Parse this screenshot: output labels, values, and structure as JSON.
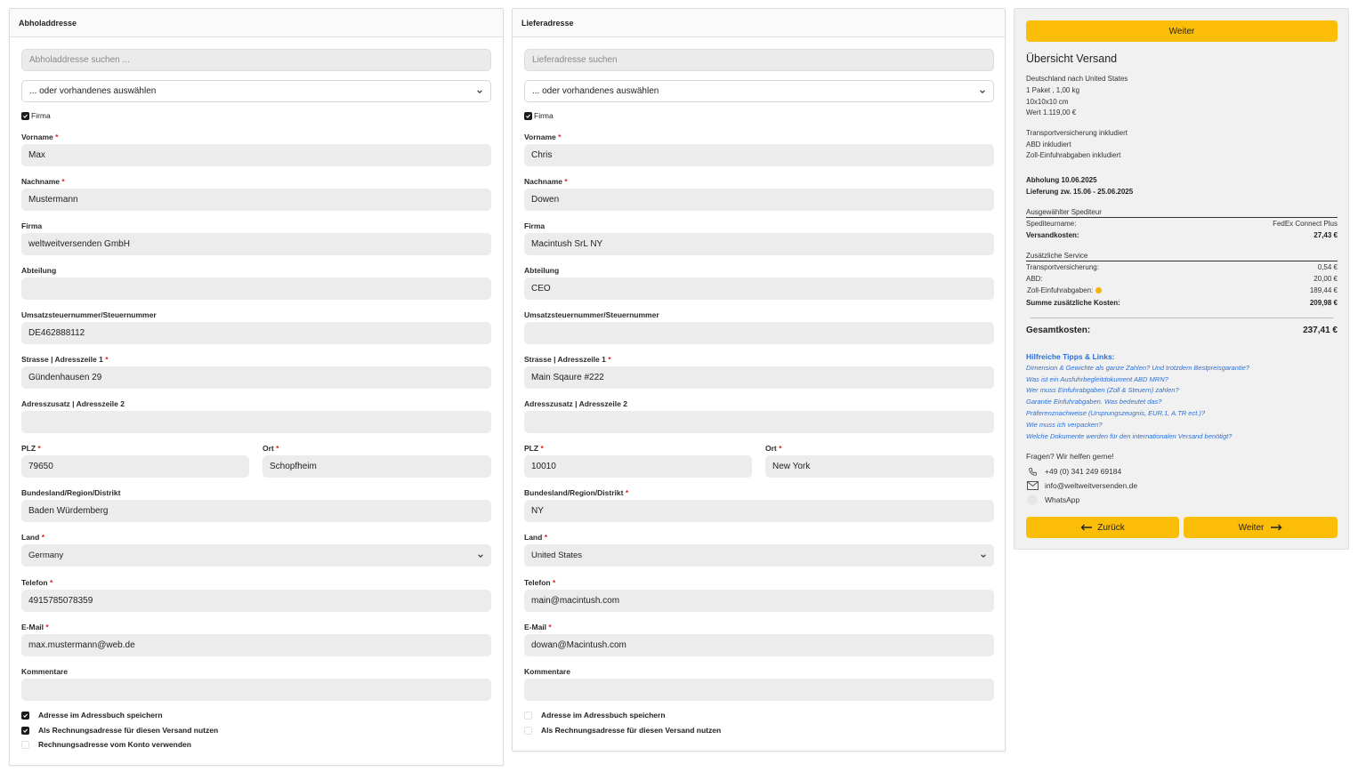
{
  "pickup": {
    "header": "Abholaddresse",
    "search_placeholder": "Abholaddresse suchen ...",
    "select_existing": "... oder vorhandenes auswählen",
    "firma_checkbox": "Firma",
    "labels": {
      "vorname": "Vorname",
      "nachname": "Nachname",
      "firma": "Firma",
      "abteilung": "Abteilung",
      "ust": "Umsatzsteuernummer/Steuernummer",
      "strasse": "Strasse | Adresszeile 1",
      "adresszusatz": "Adresszusatz | Adresszeile 2",
      "plz": "PLZ",
      "ort": "Ort",
      "bundesland": "Bundesland/Region/Distrikt",
      "land": "Land",
      "telefon": "Telefon",
      "email": "E-Mail",
      "kommentare": "Kommentare"
    },
    "values": {
      "vorname": "Max",
      "nachname": "Mustermann",
      "firma": "weltweitversenden GmbH",
      "abteilung": "",
      "ust": "DE462888112",
      "strasse": "Gündenhausen 29",
      "adresszusatz": "",
      "plz": "79650",
      "ort": "Schopfheim",
      "bundesland": "Baden Würdemberg",
      "land": "Germany",
      "telefon": "4915785078359",
      "email": "max.mustermann@web.de",
      "kommentare": ""
    },
    "options": {
      "save": "Adresse im Adressbuch speichern",
      "billing": "Als Rechnungsadresse für diesen Versand nutzen",
      "account_billing": "Rechnungsadresse vom Konto verwenden"
    }
  },
  "delivery": {
    "header": "Lieferadresse",
    "search_placeholder": "Lieferadresse suchen",
    "select_existing": "... oder vorhandenes auswählen",
    "firma_checkbox": "Firma",
    "labels": {
      "vorname": "Vorname",
      "nachname": "Nachname",
      "firma": "Firma",
      "abteilung": "Abteilung",
      "ust": "Umsatzsteuernummer/Steuernummer",
      "strasse": "Strasse | Adresszeile 1",
      "adresszusatz": "Adresszusatz | Adresszeile 2",
      "plz": "PLZ",
      "ort": "Ort",
      "bundesland": "Bundesland/Region/Distrikt",
      "land": "Land",
      "telefon": "Telefon",
      "email": "E-Mail",
      "kommentare": "Kommentare"
    },
    "values": {
      "vorname": "Chris",
      "nachname": "Dowen",
      "firma": "Macintush SrL NY",
      "abteilung": "CEO",
      "ust": "",
      "strasse": "Main Sqaure #222",
      "adresszusatz": "",
      "plz": "10010",
      "ort": "New York",
      "bundesland": "NY",
      "land": "United States",
      "telefon": "main@macintush.com",
      "email": "dowan@Macintush.com",
      "kommentare": ""
    },
    "options": {
      "save": "Adresse im Adressbuch speichern",
      "billing": "Als Rechnungsadresse für diesen Versand nutzen"
    }
  },
  "summary": {
    "weiter_top": "Weiter",
    "title": "Übersicht Versand",
    "route": "Deutschland nach United States",
    "package": "1 Paket , 1,00 kg",
    "dimensions": "10x10x10 cm",
    "value": "Wert 1.119,00 €",
    "incl_insurance": "Transportversicherung inkludiert",
    "incl_abd": "ABD inkludiert",
    "incl_customs": "Zoll-Einfuhrabgaben inkludiert",
    "pickup_date": "Abholung 10.06.2025",
    "delivery_window": "Lieferung zw. 15.06 - 25.06.2025",
    "carrier_section": "Ausgewählter Spediteur",
    "carrier_name_label": "Speditеurname:",
    "carrier_name": "FedEx Connect Plus",
    "shipping_cost_label": "Versandkosten:",
    "shipping_cost": "27,43 €",
    "extra_section": "Zusätzliche Service",
    "insurance_label": "Transportversicherung:",
    "insurance": "0,54 €",
    "abd_label": "ABD:",
    "abd": "20,00 €",
    "customs_label": "Zoll-Einfuhrabgaben:",
    "customs": "189,44 €",
    "extra_sum_label": "Summe zusätzliche Kosten:",
    "extra_sum": "209,98 €",
    "total_label": "Gesamtkosten:",
    "total": "237,41 €",
    "links_title": "Hilfreiche Tipps & Links:",
    "links": [
      "Dimension & Gewichte als ganze Zahlen? Und trotzdem Bestpreisgarantie?",
      "Was ist ein Ausfuhrbegleitdokument ABD MRN?",
      "Wer muss Einfuhrabgaben (Zoll & Steuern) zahlen?",
      "Garantie Einfuhrabgaben. Was bedeutet das?",
      "Präferenznachweise (Ursprungszeugnis, EUR.1, A.TR ect.)?",
      "Wie muss ich verpacken?",
      "Welche Dokumente werden für den internationalen Versand benötigt?"
    ],
    "help_text": "Fragen? Wir helfen gerne!",
    "phone": "+49 (0) 341 249 69184",
    "email": "info@weltweitversenden.de",
    "whatsapp": "WhatsApp",
    "back_button": "Zurück",
    "next_button": "Weiter"
  },
  "colors": {
    "accent": "#fbbd08",
    "link": "#2c6fd6",
    "required": "#dd2222",
    "input_bg": "#ececec"
  }
}
